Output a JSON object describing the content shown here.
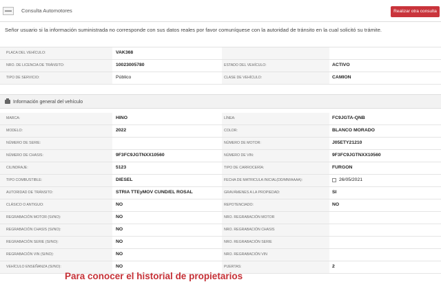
{
  "topbar": {
    "title": "Consulta Automotores",
    "button_label": "Realizar otra consulta"
  },
  "notice": "Señor usuario si la información suministrada no corresponde con sus datos reales por favor comuníquese con la autoridad de tránsito en la cual solicitó su trámite.",
  "summary": {
    "rows": [
      {
        "label1": "PLACA DEL VEHÍCULO:",
        "value1": "VAK368",
        "label2": "",
        "value2": ""
      },
      {
        "label1": "NRO. DE LICENCIA DE TRÁNSITO:",
        "value1": "10023005780",
        "label2": "ESTADO DEL VEHÍCULO:",
        "value2": "ACTIVO"
      },
      {
        "label1": "TIPO DE SERVICIO:",
        "value1": "Público",
        "label2": "CLASE DE VEHÍCULO:",
        "value2": "CAMION"
      }
    ]
  },
  "section": {
    "icon": "car-icon",
    "title": "Información general del vehículo"
  },
  "general": {
    "rows": [
      {
        "label1": "MARCA:",
        "value1": "HINO",
        "label2": "LÍNEA:",
        "value2": "FC9JGTA-QNB"
      },
      {
        "label1": "MODELO:",
        "value1": "2022",
        "label2": "COLOR:",
        "value2": "BLANCO MORADO"
      },
      {
        "label1": "NÚMERO DE SERIE:",
        "value1": "",
        "label2": "NÚMERO DE MOTOR:",
        "value2": "J05ETY21210"
      },
      {
        "label1": "NÚMERO DE CHASIS:",
        "value1": "9F3FC9JGTNXX10560",
        "label2": "NÚMERO DE VIN:",
        "value2": "9F3FC9JGTNXX10560"
      },
      {
        "label1": "CILINDRAJE:",
        "value1": "5123",
        "label2": "TIPO DE CARROCERÍA:",
        "value2": "FURGON"
      },
      {
        "label1": "TIPO COMBUSTIBLE:",
        "value1": "DIESEL",
        "label2": "FECHA DE MATRICULA INICIAL(DD/MM/AAAA):",
        "value2": "26/05/2021"
      },
      {
        "label1": "AUTORIDAD DE TRÁNSITO:",
        "value1": "STRIA TTEyMOV CUND/EL ROSAL",
        "label2": "GRAVÁMENES A LA PROPIEDAD:",
        "value2": "SI"
      },
      {
        "label1": "CLÁSICO O ANTIGUO:",
        "value1": "NO",
        "label2": "REPOTENCIADO:",
        "value2": "NO"
      },
      {
        "label1": "REGRABACIÓN MOTOR (SI/NO):",
        "value1": "NO",
        "label2": "NRO. REGRABACIÓN MOTOR",
        "value2": ""
      },
      {
        "label1": "REGRABACIÓN CHASIS (SI/NO):",
        "value1": "NO",
        "label2": "NRO. REGRABACIÓN CHASIS",
        "value2": ""
      },
      {
        "label1": "REGRABACIÓN SERIE (SI/NO):",
        "value1": "NO",
        "label2": "NRO. REGRABACIÓN SERIE",
        "value2": ""
      },
      {
        "label1": "REGRABACIÓN VIN (SI/NO):",
        "value1": "NO",
        "label2": "NRO. REGRABACIÓN VIN",
        "value2": ""
      },
      {
        "label1": "VEHÍCULO ENSEÑANZA (SI/NO):",
        "value1": "NO",
        "label2": "PUERTAS:",
        "value2": "2"
      }
    ]
  },
  "caption": "Para conocer el historial de propietarios",
  "colors": {
    "accent_button": "#c9343b",
    "caption": "#c53036"
  }
}
